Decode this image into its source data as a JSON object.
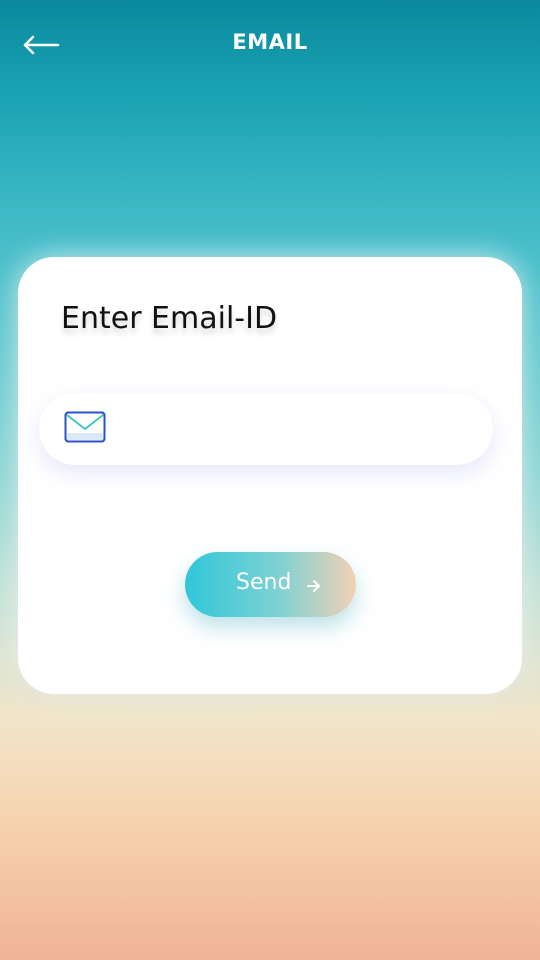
{
  "header": {
    "title": "EMAIL",
    "back_icon": "back-arrow-icon"
  },
  "card": {
    "heading": "Enter Email-ID",
    "email_input": {
      "value": "",
      "placeholder": "",
      "icon": "mail-icon"
    },
    "send_button": {
      "label": "Send",
      "icon": "arrow-right-icon"
    }
  },
  "colors": {
    "primary_teal": "#2fc7d8",
    "peach": "#f1d1b4",
    "mail_icon_stroke": "#2a52c9"
  }
}
